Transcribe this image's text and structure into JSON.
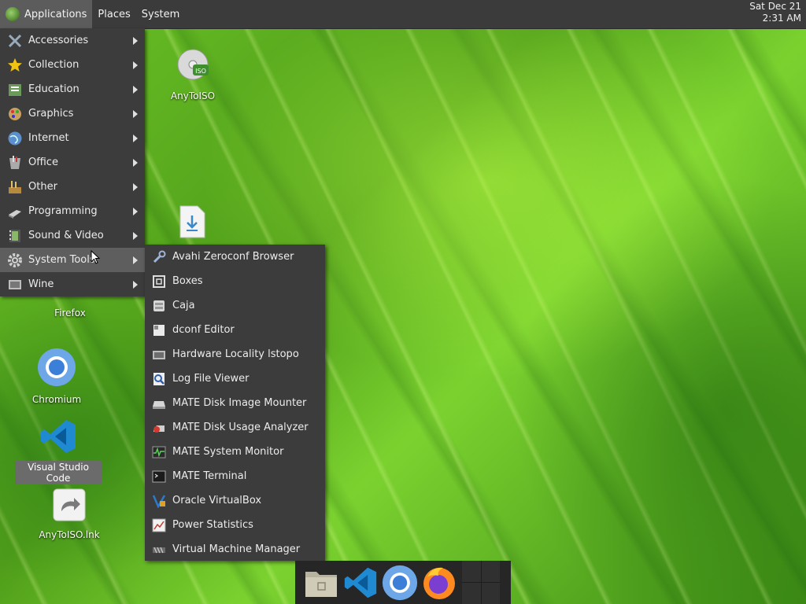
{
  "panel": {
    "menus": [
      "Applications",
      "Places",
      "System"
    ],
    "clock": {
      "date": "Sat Dec 21",
      "time": "2:31 AM"
    }
  },
  "desktop": {
    "icons": [
      {
        "label": "AnyToISO",
        "icon": "disc-iso-icon"
      },
      {
        "label": "",
        "icon": "download-file-icon"
      },
      {
        "label": "Firefox",
        "icon": "firefox-icon"
      },
      {
        "label": "Chromium",
        "icon": "chromium-icon"
      },
      {
        "label": "Visual Studio Code",
        "icon": "vscode-icon",
        "selected": true
      },
      {
        "label": "AnyToISO.lnk",
        "icon": "shortcut-icon"
      }
    ]
  },
  "applications_menu": {
    "items": [
      {
        "label": "Accessories",
        "icon": "accessories-icon"
      },
      {
        "label": "Collection",
        "icon": "star-icon"
      },
      {
        "label": "Education",
        "icon": "education-icon"
      },
      {
        "label": "Graphics",
        "icon": "graphics-icon"
      },
      {
        "label": "Internet",
        "icon": "globe-icon"
      },
      {
        "label": "Office",
        "icon": "office-icon"
      },
      {
        "label": "Other",
        "icon": "other-icon"
      },
      {
        "label": "Programming",
        "icon": "programming-icon"
      },
      {
        "label": "Sound & Video",
        "icon": "film-icon"
      },
      {
        "label": "System Tools",
        "icon": "gear-icon",
        "hover": true
      },
      {
        "label": "Wine",
        "icon": "wine-icon"
      }
    ]
  },
  "system_tools_submenu": {
    "items": [
      {
        "label": "Avahi Zeroconf Browser",
        "icon": "wrench-icon"
      },
      {
        "label": "Boxes",
        "icon": "boxes-icon"
      },
      {
        "label": "Caja",
        "icon": "file-manager-icon"
      },
      {
        "label": "dconf Editor",
        "icon": "dconf-icon"
      },
      {
        "label": "Hardware Locality lstopo",
        "icon": "hardware-icon"
      },
      {
        "label": "Log File Viewer",
        "icon": "log-viewer-icon"
      },
      {
        "label": "MATE Disk Image Mounter",
        "icon": "disk-mounter-icon"
      },
      {
        "label": "MATE Disk Usage Analyzer",
        "icon": "disk-usage-icon"
      },
      {
        "label": "MATE System Monitor",
        "icon": "system-monitor-icon"
      },
      {
        "label": "MATE Terminal",
        "icon": "terminal-icon"
      },
      {
        "label": "Oracle VirtualBox",
        "icon": "virtualbox-icon"
      },
      {
        "label": "Power Statistics",
        "icon": "power-stats-icon"
      },
      {
        "label": "Virtual Machine Manager",
        "icon": "vm-manager-icon"
      }
    ]
  },
  "dock": {
    "items": [
      {
        "icon": "file-manager-icon"
      },
      {
        "icon": "vscode-icon"
      },
      {
        "icon": "chromium-icon"
      },
      {
        "icon": "firefox-icon"
      }
    ]
  }
}
